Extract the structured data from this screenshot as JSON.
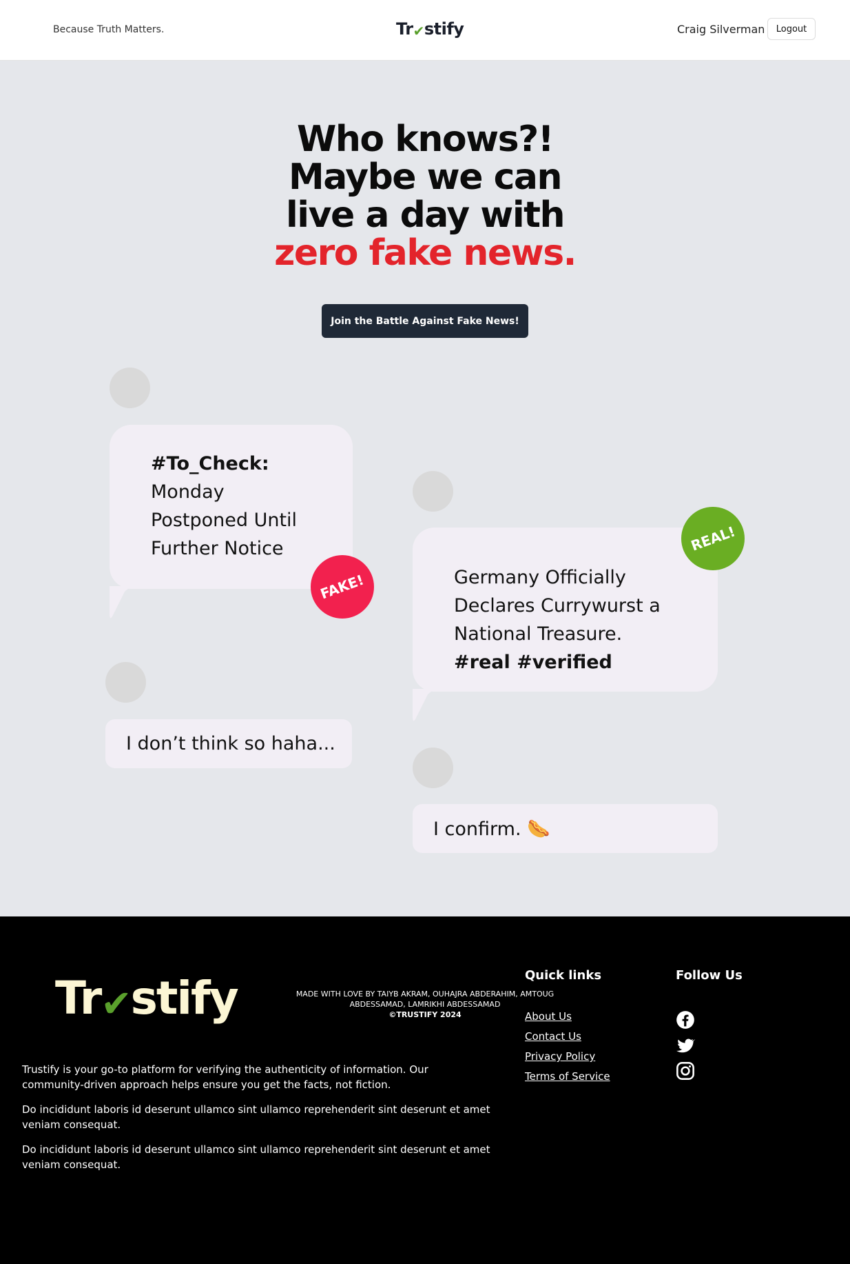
{
  "header": {
    "tagline": "Because Truth Matters.",
    "logo_left": "Tr",
    "logo_right": "stify",
    "username": "Craig Silverman",
    "logout_label": "Logout"
  },
  "hero": {
    "line1": "Who knows?!",
    "line2": "Maybe we can",
    "line3": "live a day with",
    "line4": "zero fake news.",
    "cta_label": "Join the Battle Against Fake News!"
  },
  "chat": {
    "bubble1": {
      "tag": "#To_Check:",
      "line1": "Monday",
      "line2": "Postponed Until",
      "line3": "Further Notice"
    },
    "bubble1_stamp": "FAKE!",
    "bubble2": {
      "line1": "Germany Officially",
      "line2": "Declares Currywurst a",
      "line3": "National Treasure.",
      "tag": "#real #verified"
    },
    "bubble2_stamp": "REAL!",
    "reply1": "I don’t think so haha...",
    "reply2": "I confirm. 🌭"
  },
  "footer": {
    "logo_left": "Tr",
    "logo_right": "stify",
    "paragraphs": [
      "Trustify is your go-to platform for verifying the authenticity of information. Our community-driven approach helps ensure you get the facts, not fiction.",
      "Do incididunt laboris id deserunt ullamco sint ullamco reprehenderit sint deserunt et amet veniam consequat.",
      "Do incididunt laboris id deserunt ullamco sint ullamco reprehenderit sint deserunt et amet veniam consequat."
    ],
    "quick_links_title": "Quick links",
    "quick_links": [
      "About Us",
      "Contact Us",
      "Privacy Policy",
      "Terms of Service"
    ],
    "follow_title": "Follow Us",
    "social_icons": [
      "facebook-icon",
      "twitter-icon",
      "instagram-icon"
    ],
    "credits_line1": "MADE WITH LOVE BY TAIYB AKRAM, OUHAJRA ABDERAHIM, AMTOUG",
    "credits_line2": "ABDESSAMAD, LAMRIKHI ABDESSAMAD",
    "copyright": "©TRUSTIFY 2024"
  },
  "colors": {
    "accent_red": "#e3242b",
    "fake_stamp": "#f2214e",
    "real_stamp": "#6aae23",
    "cta_bg": "#1f2937",
    "logo_check": "#5aa02c"
  }
}
